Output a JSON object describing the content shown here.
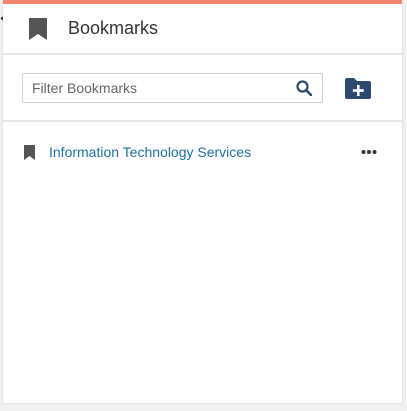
{
  "header": {
    "title": "Bookmarks",
    "icon": "bookmark-icon",
    "accent_color": "#f0876e"
  },
  "toolbar": {
    "filter_placeholder": "Filter Bookmarks",
    "filter_value": "",
    "search_icon": "search-icon",
    "add_folder_icon": "folder-plus-icon"
  },
  "bookmarks": [
    {
      "label": "Information Technology Services",
      "icon": "bookmark-icon",
      "menu_icon": "more-horizontal-icon"
    }
  ],
  "colors": {
    "link": "#1f6f9f",
    "icon": "#555555",
    "folder_icon": "#2c4a6e"
  }
}
